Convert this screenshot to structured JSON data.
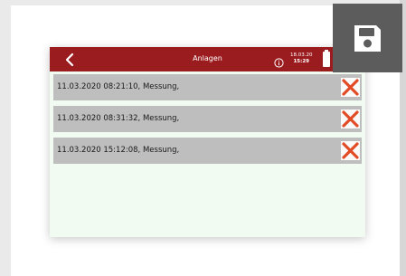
{
  "header": {
    "title": "Anlagen",
    "date": "18.03.20",
    "time": "15:29"
  },
  "rows": [
    {
      "label": "11.03.2020 08:21:10, Messung,"
    },
    {
      "label": "11.03.2020 08:31:32, Messung,"
    },
    {
      "label": "11.03.2020 15:12:08, Messung,"
    }
  ],
  "icons": {
    "back": "chevron-left-icon",
    "info": "info-icon",
    "battery": "battery-icon",
    "delete": "x-icon",
    "save": "floppy-disk-icon"
  },
  "colors": {
    "header_bg": "#9b1c1f",
    "row_bg": "#bebebe",
    "content_bg": "#f1fbf1",
    "delete_x": "#e14b26",
    "save_bg": "#5c5c5c"
  }
}
